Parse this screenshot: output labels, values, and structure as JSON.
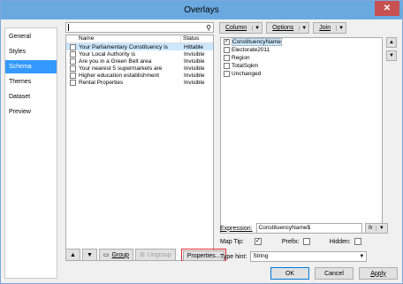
{
  "window": {
    "title": "Overlays",
    "close": "✕"
  },
  "nav": {
    "items": [
      {
        "label": "General",
        "selected": false
      },
      {
        "label": "Styles",
        "selected": false
      },
      {
        "label": "Schema",
        "selected": true
      },
      {
        "label": "Themes",
        "selected": false
      },
      {
        "label": "Dataset",
        "selected": false
      },
      {
        "label": "Preview",
        "selected": false
      }
    ]
  },
  "search": {
    "placeholder": "",
    "icon": "search-icon"
  },
  "overlay_list": {
    "columns": [
      "Name",
      "Status"
    ],
    "rows": [
      {
        "name": "Your Parliamentary Constituency is",
        "status": "Hittable",
        "selected": true
      },
      {
        "name": "Your Local Authority is",
        "status": "Invisible",
        "selected": false
      },
      {
        "name": "Are you in a Green Belt area",
        "status": "Invisible",
        "selected": false
      },
      {
        "name": "Your nearest 5 supermarkets are",
        "status": "Invisible",
        "selected": false
      },
      {
        "name": "Higher education establishment",
        "status": "Invisible",
        "selected": false
      },
      {
        "name": "Rental Properties",
        "status": "Invisible",
        "selected": false
      }
    ]
  },
  "bottom_buttons": {
    "up": "▲",
    "down": "▼",
    "group": "Group",
    "ungroup": "Ungroup",
    "properties": "Properties..."
  },
  "toolbar": {
    "column": "Column",
    "options": "Options",
    "join": "Join"
  },
  "fields": [
    {
      "label": "ConstituencyName",
      "checked": true
    },
    {
      "label": "Electorate2011",
      "checked": false
    },
    {
      "label": "Region",
      "checked": false
    },
    {
      "label": "TotalSqkm",
      "checked": false
    },
    {
      "label": "Unchanged",
      "checked": false
    }
  ],
  "field_move": {
    "up": "▲",
    "down": "▼"
  },
  "expression": {
    "label": "Expression:",
    "value": "ConstituencyName$",
    "fx": "fx"
  },
  "options_row": {
    "maptip_label": "Map Tip:",
    "maptip_checked": true,
    "prefix_label": "Prefix:",
    "prefix_checked": false,
    "hidden_label": "Hidden:",
    "hidden_checked": false
  },
  "type_hint": {
    "label": "Type hint:",
    "value": "String"
  },
  "footer": {
    "ok": "OK",
    "cancel": "Cancel",
    "apply": "Apply"
  }
}
